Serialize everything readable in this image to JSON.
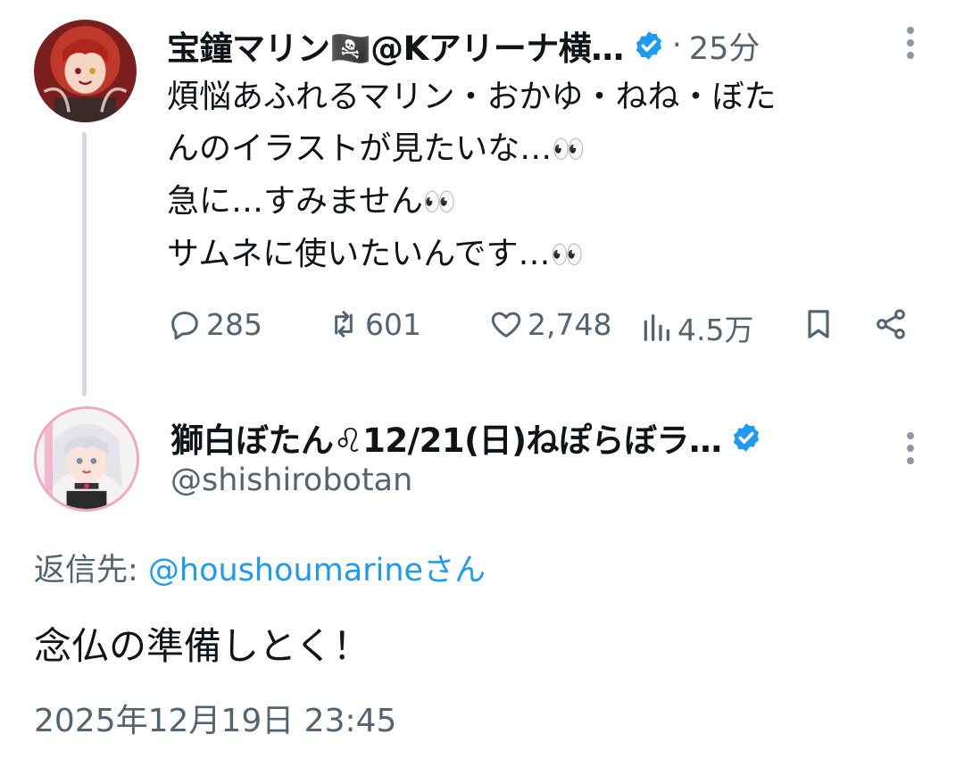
{
  "tweet": {
    "author_name": "宝鐘マリン🏴‍☠️@Kアリーナ横…",
    "separator": "·",
    "time_ago": "25分",
    "avatar_icon": "user-avatar-red-hair",
    "lines": [
      "煩悩あふれるマリン・おかゆ・ねね・ぼた",
      "んのイラストが見たいな…",
      "急に…すみません",
      "サムネに使いたいんです…"
    ],
    "eyes_emoji": "👀",
    "stats": {
      "replies": "285",
      "reposts": "601",
      "likes": "2,748",
      "views": "4.5万"
    }
  },
  "reply": {
    "author_name": "獅白ぼたん♌12/21(日)ねぽらぼラ…",
    "handle": "@shishirobotan",
    "avatar_icon": "user-avatar-white-hair",
    "reply_to_label": "返信先: ",
    "reply_to_mention": "@houshoumarineさん",
    "text": "念仏の準備しとく！",
    "timestamp": "2025年12月19日 23:45"
  },
  "colors": {
    "text": "#0f1419",
    "secondary": "#536471",
    "accent": "#1d9bf0",
    "thread_line": "#cfd9de"
  }
}
